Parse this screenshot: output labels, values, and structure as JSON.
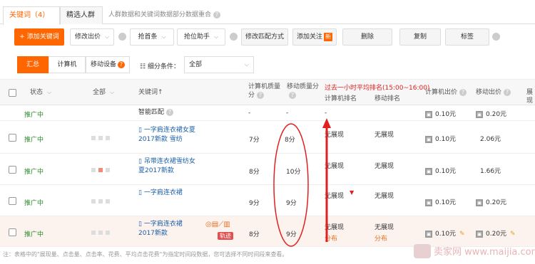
{
  "tabs": {
    "keywords": "关键词（4）",
    "crowd": "精选人群",
    "note": "人群数据和关键词数据部分数据重合"
  },
  "toolbar": {
    "add_keyword": "+ 添加关键词",
    "modify_bid": "修改出价",
    "grab_position": "抢首条",
    "grab_helper": "抢位助手",
    "modify_match": "修改匹配方式",
    "add_follow": "添加关注",
    "new_badge": "新",
    "delete": "删除",
    "copy": "复制",
    "tag": "标签"
  },
  "segment": {
    "summary": "汇总",
    "computer": "计算机",
    "mobile": "移动设备",
    "condition_label": "细分条件：",
    "condition_value": "全部"
  },
  "headers": {
    "status": "状态",
    "all": "全部",
    "keyword": "关键词↑",
    "pc_quality": "计算机质量分",
    "mobile_quality": "移动质量分",
    "pc_rank": "计算机排名",
    "mobile_rank": "移动排名",
    "pc_bid": "计算机出价",
    "mobile_bid": "移动出价",
    "more": "展现"
  },
  "annotation": "过去一小时平均排名(15:00~16:00)",
  "rows": [
    {
      "status": "推广中",
      "keyword": "智能匹配",
      "pc_q": "-",
      "m_q": "-",
      "pc_rank": "-",
      "m_rank": "",
      "pc_bid": "0.10元",
      "m_bid": "0.20元"
    },
    {
      "status": "推广中",
      "keyword": "一字肩连衣裙女夏2017新款 雪纺",
      "pc_q": "7分",
      "m_q": "8分",
      "pc_rank": "无展现",
      "m_rank": "无展现",
      "pc_bid": "0.10元",
      "m_bid": "2.06元"
    },
    {
      "status": "推广中",
      "keyword": "吊带连衣裙雪纺女夏2017新款",
      "pc_q": "8分",
      "m_q": "10分",
      "pc_rank": "无展现",
      "m_rank": "无展现",
      "pc_bid": "0.10元",
      "m_bid": "1.66元"
    },
    {
      "status": "推广中",
      "keyword": "一字肩连衣裙",
      "pc_q": "9分",
      "m_q": "9分",
      "pc_rank": "无展现",
      "m_rank": "无展现",
      "pc_bid": "0.10元",
      "m_bid": "0.20元"
    },
    {
      "status": "推广中",
      "keyword": "一字肩连衣裙 2017新款",
      "pc_q": "8分",
      "m_q": "9分",
      "pc_rank": "无展现",
      "m_rank": "无展现",
      "pc_bid": "0.10元",
      "m_bid": "0.20元",
      "pc_dist": "分布",
      "m_dist": "分布",
      "track": "轨迹"
    }
  ],
  "footnote": "注：表格中的\"展现量、点击量、点击率、花费、平均点击花费\"为指定时间段数据，您可选择不同时间段来查看。",
  "watermark": "卖家网 www.maijia.com",
  "colors": {
    "accent": "#ff6600",
    "status_green": "#2a8a2a",
    "link_blue": "#1a5fa8",
    "annotation_red": "#e02020"
  }
}
